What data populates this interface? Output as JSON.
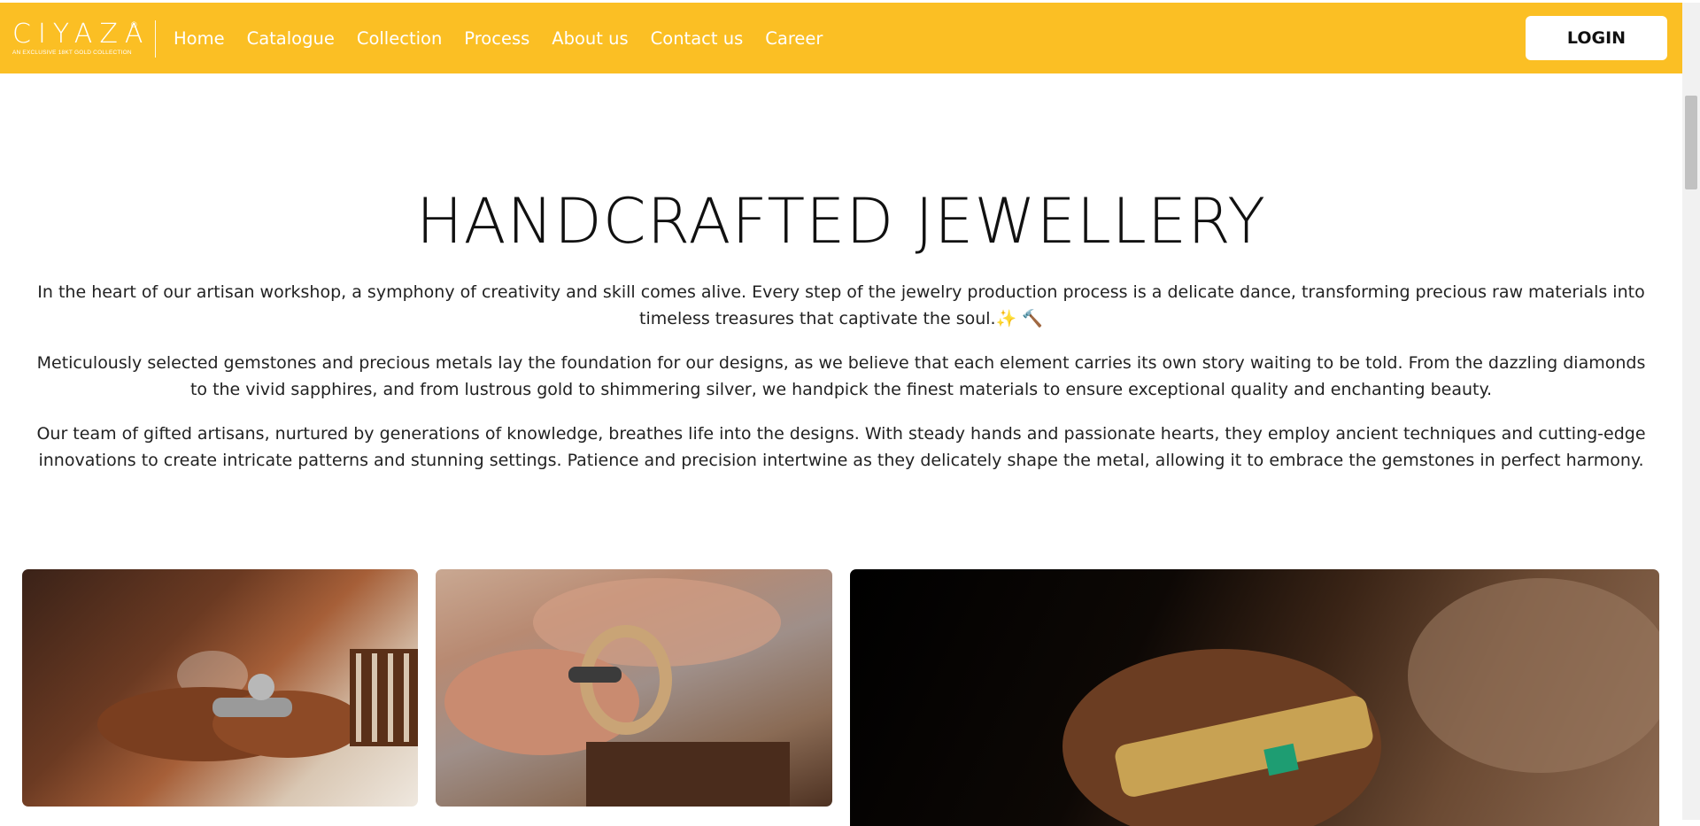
{
  "brand": {
    "logo_text": "CIYAZA",
    "registered_mark": "®",
    "tagline": "AN EXCLUSIVE 18KT GOLD COLLECTION"
  },
  "nav": {
    "links": [
      "Home",
      "Catalogue",
      "Collection",
      "Process",
      "About us",
      "Contact us",
      "Career"
    ],
    "login_label": "LOGIN"
  },
  "hero": {
    "title": "HANDCRAFTED JEWELLERY",
    "paragraphs": [
      "In the heart of our artisan workshop, a symphony of creativity and skill comes alive. Every step of the jewelry production process is a delicate dance, transforming precious raw materials into timeless treasures that captivate the soul.✨ 🔨",
      "Meticulously selected gemstones and precious metals lay the foundation for our designs, as we believe that each element carries its own story waiting to be told. From the dazzling diamonds to the vivid sapphires, and from lustrous gold to shimmering silver, we handpick the finest materials to ensure exceptional quality and enchanting beauty.",
      "Our team of gifted artisans, nurtured by generations of knowledge, breathes life into the designs. With steady hands and passionate hearts, they employ ancient techniques and cutting-edge innovations to create intricate patterns and stunning settings. Patience and precision intertwine as they delicately shape the metal, allowing it to embrace the gemstones in perfect harmony."
    ]
  },
  "colors": {
    "navbar": "#fbbf24",
    "nav_text": "#ffffff",
    "page_bg": "#ffffff"
  }
}
